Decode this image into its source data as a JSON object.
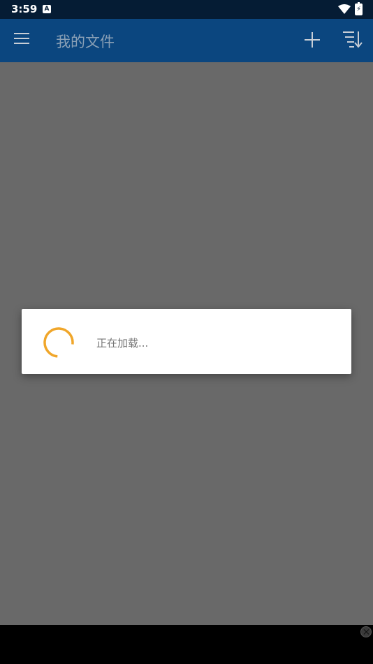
{
  "status_bar": {
    "time": "3:59",
    "notification_icon": "a-icon",
    "battery_glyph": "⚡"
  },
  "app_bar": {
    "title": "我的文件",
    "menu_icon": "hamburger-menu-icon",
    "add_icon": "plus-icon",
    "sort_icon": "sort-icon",
    "background_color": "#0b467f"
  },
  "dialog": {
    "loading_text": "正在加载...",
    "spinner_color": "#f0a62a"
  },
  "overlay_color": "#696969"
}
